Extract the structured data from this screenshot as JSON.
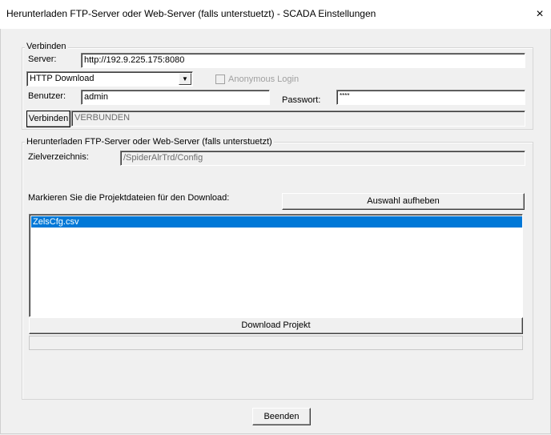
{
  "window": {
    "title": "Herunterladen FTP-Server oder Web-Server (falls unterstuetzt) - SCADA Einstellungen",
    "close_glyph": "×"
  },
  "connect": {
    "legend": "Verbinden",
    "server_label": "Server:",
    "server_value": "http://192.9.225.175:8080",
    "protocol_selected": "HTTP Download",
    "anonymous_label": "Anonymous Login",
    "anonymous_checked": false,
    "user_label": "Benutzer:",
    "user_value": "admin",
    "password_label": "Passwort:",
    "password_value": "****",
    "connect_button": "Verbinden",
    "status_value": "VERBUNDEN"
  },
  "download": {
    "legend": "Herunterladen FTP-Server oder Web-Server (falls unterstuetzt)",
    "target_label": "Zielverzeichnis:",
    "target_value": "/SpiderAlrTrd/Config",
    "mark_label": "Markieren Sie die Projektdateien für den Download:",
    "deselect_button": "Auswahl aufheben",
    "files": [
      {
        "name": "ZelsCfg.csv",
        "selected": true
      }
    ],
    "download_button": "Download Projekt",
    "progress": 0
  },
  "footer": {
    "close_button": "Beenden"
  },
  "colors": {
    "selection": "#0078d7",
    "dialog_bg": "#f0f0f0"
  }
}
